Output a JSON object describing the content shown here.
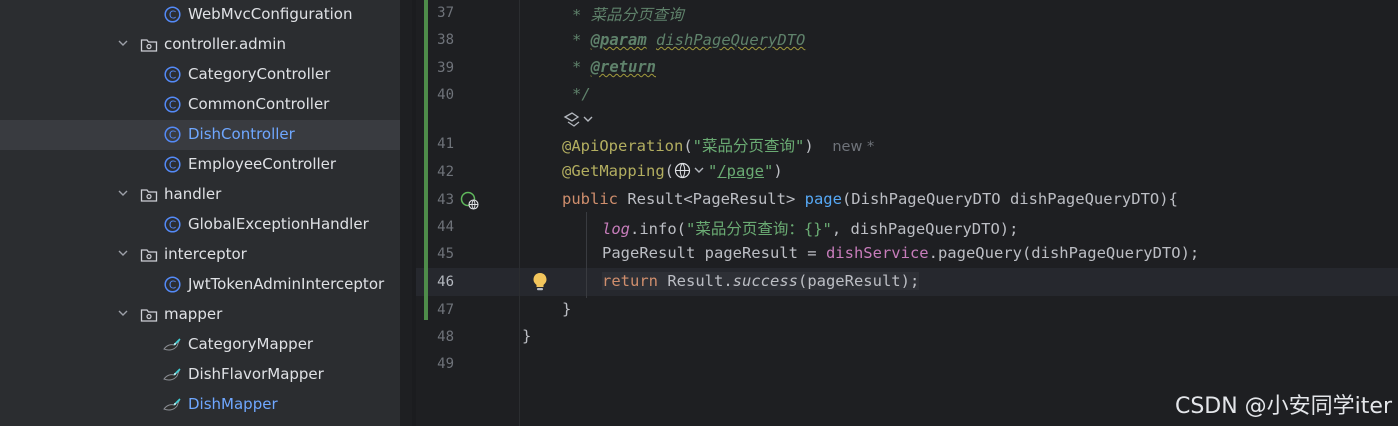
{
  "tree": {
    "items": [
      {
        "label": "WebMvcConfiguration",
        "kind": "class"
      },
      {
        "label": "controller.admin",
        "kind": "folder"
      },
      {
        "label": "CategoryController",
        "kind": "class"
      },
      {
        "label": "CommonController",
        "kind": "class"
      },
      {
        "label": "DishController",
        "kind": "class",
        "selected": true
      },
      {
        "label": "EmployeeController",
        "kind": "class"
      },
      {
        "label": "handler",
        "kind": "folder"
      },
      {
        "label": "GlobalExceptionHandler",
        "kind": "class"
      },
      {
        "label": "interceptor",
        "kind": "folder"
      },
      {
        "label": "JwtTokenAdminInterceptor",
        "kind": "class"
      },
      {
        "label": "mapper",
        "kind": "folder"
      },
      {
        "label": "CategoryMapper",
        "kind": "mapper"
      },
      {
        "label": "DishFlavorMapper",
        "kind": "mapper"
      },
      {
        "label": "DishMapper",
        "kind": "mapper",
        "highlight": true
      }
    ]
  },
  "editor": {
    "line_numbers": [
      "37",
      "38",
      "39",
      "40",
      "41",
      "42",
      "43",
      "44",
      "45",
      "46",
      "47",
      "48",
      "49"
    ],
    "active_line": "46",
    "lines": {
      "l37": "* 菜品分页查询",
      "l38_star": "* ",
      "l38_tag": "@param",
      "l38_param": "dishPageQueryDTO",
      "l39_star": "* ",
      "l39_tag": "@return",
      "l40": "*/",
      "l41_ann": "@ApiOperation",
      "l41_open": "(",
      "l41_str": "\"菜品分页查询\"",
      "l41_close": ")",
      "l41_hint": "new *",
      "l42_ann": "@GetMapping",
      "l42_open": "(",
      "l42_q1": "\"",
      "l42_path": "/page",
      "l42_q2": "\"",
      "l42_close": ")",
      "l43_kw": "public",
      "l43_type": " Result<PageResult> ",
      "l43_fn": "page",
      "l43_rest": "(DishPageQueryDTO dishPageQueryDTO){",
      "l44_log": "log",
      "l44_mid": ".info(",
      "l44_str": "\"菜品分页查询：{}\"",
      "l44_rest": ", dishPageQueryDTO);",
      "l45_pre": "PageResult pageResult = ",
      "l45_fld": "dishService",
      "l45_rest": ".pageQuery(dishPageQueryDTO);",
      "l46_kw": "return",
      "l46_cls": " Result.",
      "l46_fn": "success",
      "l46_rest": "(pageResult);",
      "l47": "}",
      "l48": "}"
    }
  },
  "watermark": "CSDN @小安同学iter",
  "colors": {
    "keyword": "#cf8e6d",
    "annotation": "#b3ae60",
    "string": "#6aab73",
    "comment": "#5f826b",
    "function": "#56a8f5",
    "field": "#c77dbb",
    "selected_text": "#6fa7ff",
    "vcs_bar": "#4e8c4a"
  }
}
